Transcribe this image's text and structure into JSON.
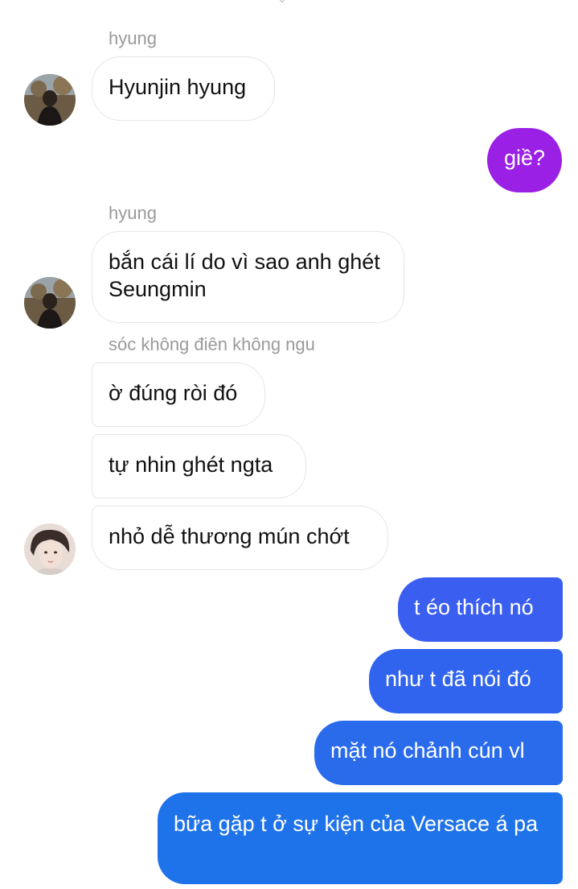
{
  "conversation": {
    "messages": [
      {
        "sender": "hyung",
        "text": "Hyunjin hyung",
        "direction": "incoming"
      },
      {
        "text": "giề?",
        "direction": "outgoing",
        "color": "#9b20e6"
      },
      {
        "sender": "hyung",
        "text": "bắn cái lí do vì sao anh ghét Seungmin",
        "direction": "incoming"
      },
      {
        "sender": "sóc không điên không ngu",
        "text": "ờ đúng ròi đó",
        "direction": "incoming"
      },
      {
        "text": "tự nhin ghét ngta",
        "direction": "incoming"
      },
      {
        "text": "nhỏ dễ thương mún chớt",
        "direction": "incoming"
      },
      {
        "text": "t éo thích nó",
        "direction": "outgoing",
        "color": "#3a5ef0"
      },
      {
        "text": "như t đã nói đó",
        "direction": "outgoing",
        "color": "#3164ee"
      },
      {
        "text": "mặt nó chảnh cún vl",
        "direction": "outgoing",
        "color": "#2a6bec"
      },
      {
        "text": "bữa gặp t ở sự kiện của Versace á pa",
        "direction": "outgoing",
        "color": "#1f73ea"
      }
    ]
  },
  "avatars": {
    "hyung": "avatar-hyung",
    "soc": "avatar-soc"
  }
}
